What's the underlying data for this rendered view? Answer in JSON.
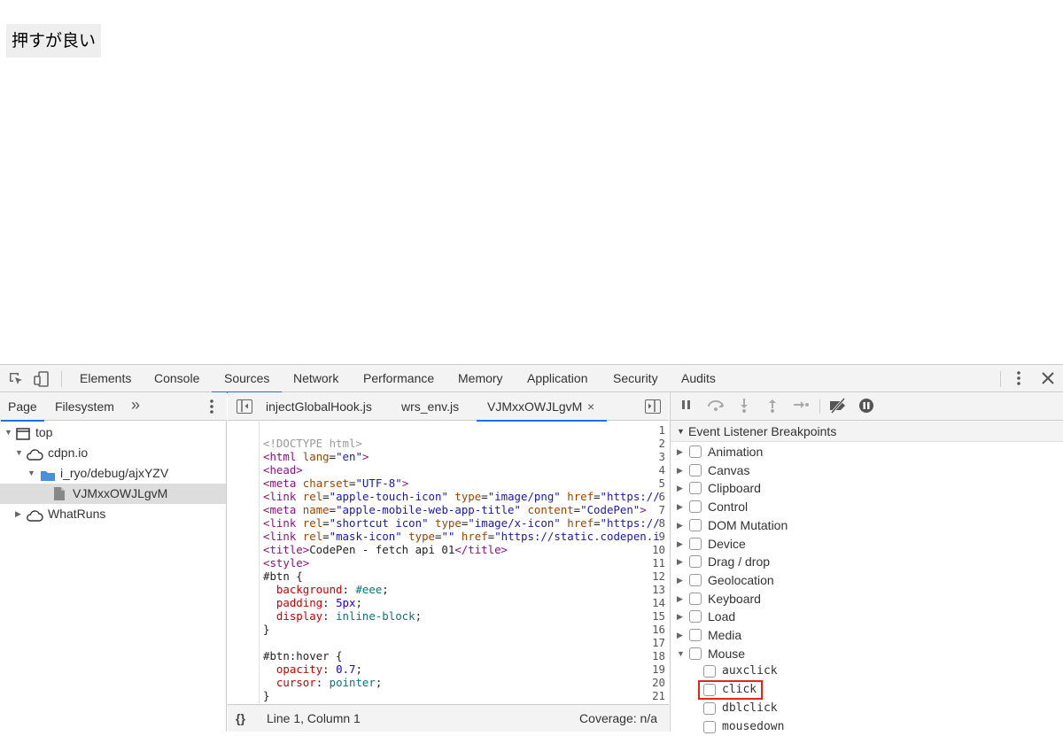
{
  "page": {
    "button_label": "押すが良い"
  },
  "devtools": {
    "tabs": [
      "Elements",
      "Console",
      "Sources",
      "Network",
      "Performance",
      "Memory",
      "Application",
      "Security",
      "Audits"
    ],
    "active_tab": "Sources",
    "navigator": {
      "tabs": [
        "Page",
        "Filesystem"
      ],
      "more": "»",
      "tree": [
        {
          "label": "top",
          "icon": "frame-icon"
        },
        {
          "label": "cdpn.io",
          "icon": "cloud-icon"
        },
        {
          "label": "i_ryo/debug/ajxYZV",
          "icon": "folder-icon"
        },
        {
          "label": "VJMxxOWJLgvM",
          "icon": "file-icon"
        },
        {
          "label": "WhatRuns",
          "icon": "cloud-icon"
        }
      ]
    },
    "editor": {
      "tabs": [
        "injectGlobalHook.js",
        "wrs_env.js",
        "VJMxxOWJLgvM"
      ],
      "close_glyph": "×",
      "status": {
        "format": "{}",
        "position": "Line 1, Column 1",
        "coverage": "Coverage: n/a"
      }
    },
    "debugger": {
      "section_title": "Event Listener Breakpoints",
      "categories": [
        "Animation",
        "Canvas",
        "Clipboard",
        "Control",
        "DOM Mutation",
        "Device",
        "Drag / drop",
        "Geolocation",
        "Keyboard",
        "Load",
        "Media",
        "Mouse"
      ],
      "mouse_events": [
        "auxclick",
        "click",
        "dblclick",
        "mousedown"
      ]
    }
  },
  "colors": {
    "accent": "#1a73e8",
    "highlight": "#e0281a"
  }
}
